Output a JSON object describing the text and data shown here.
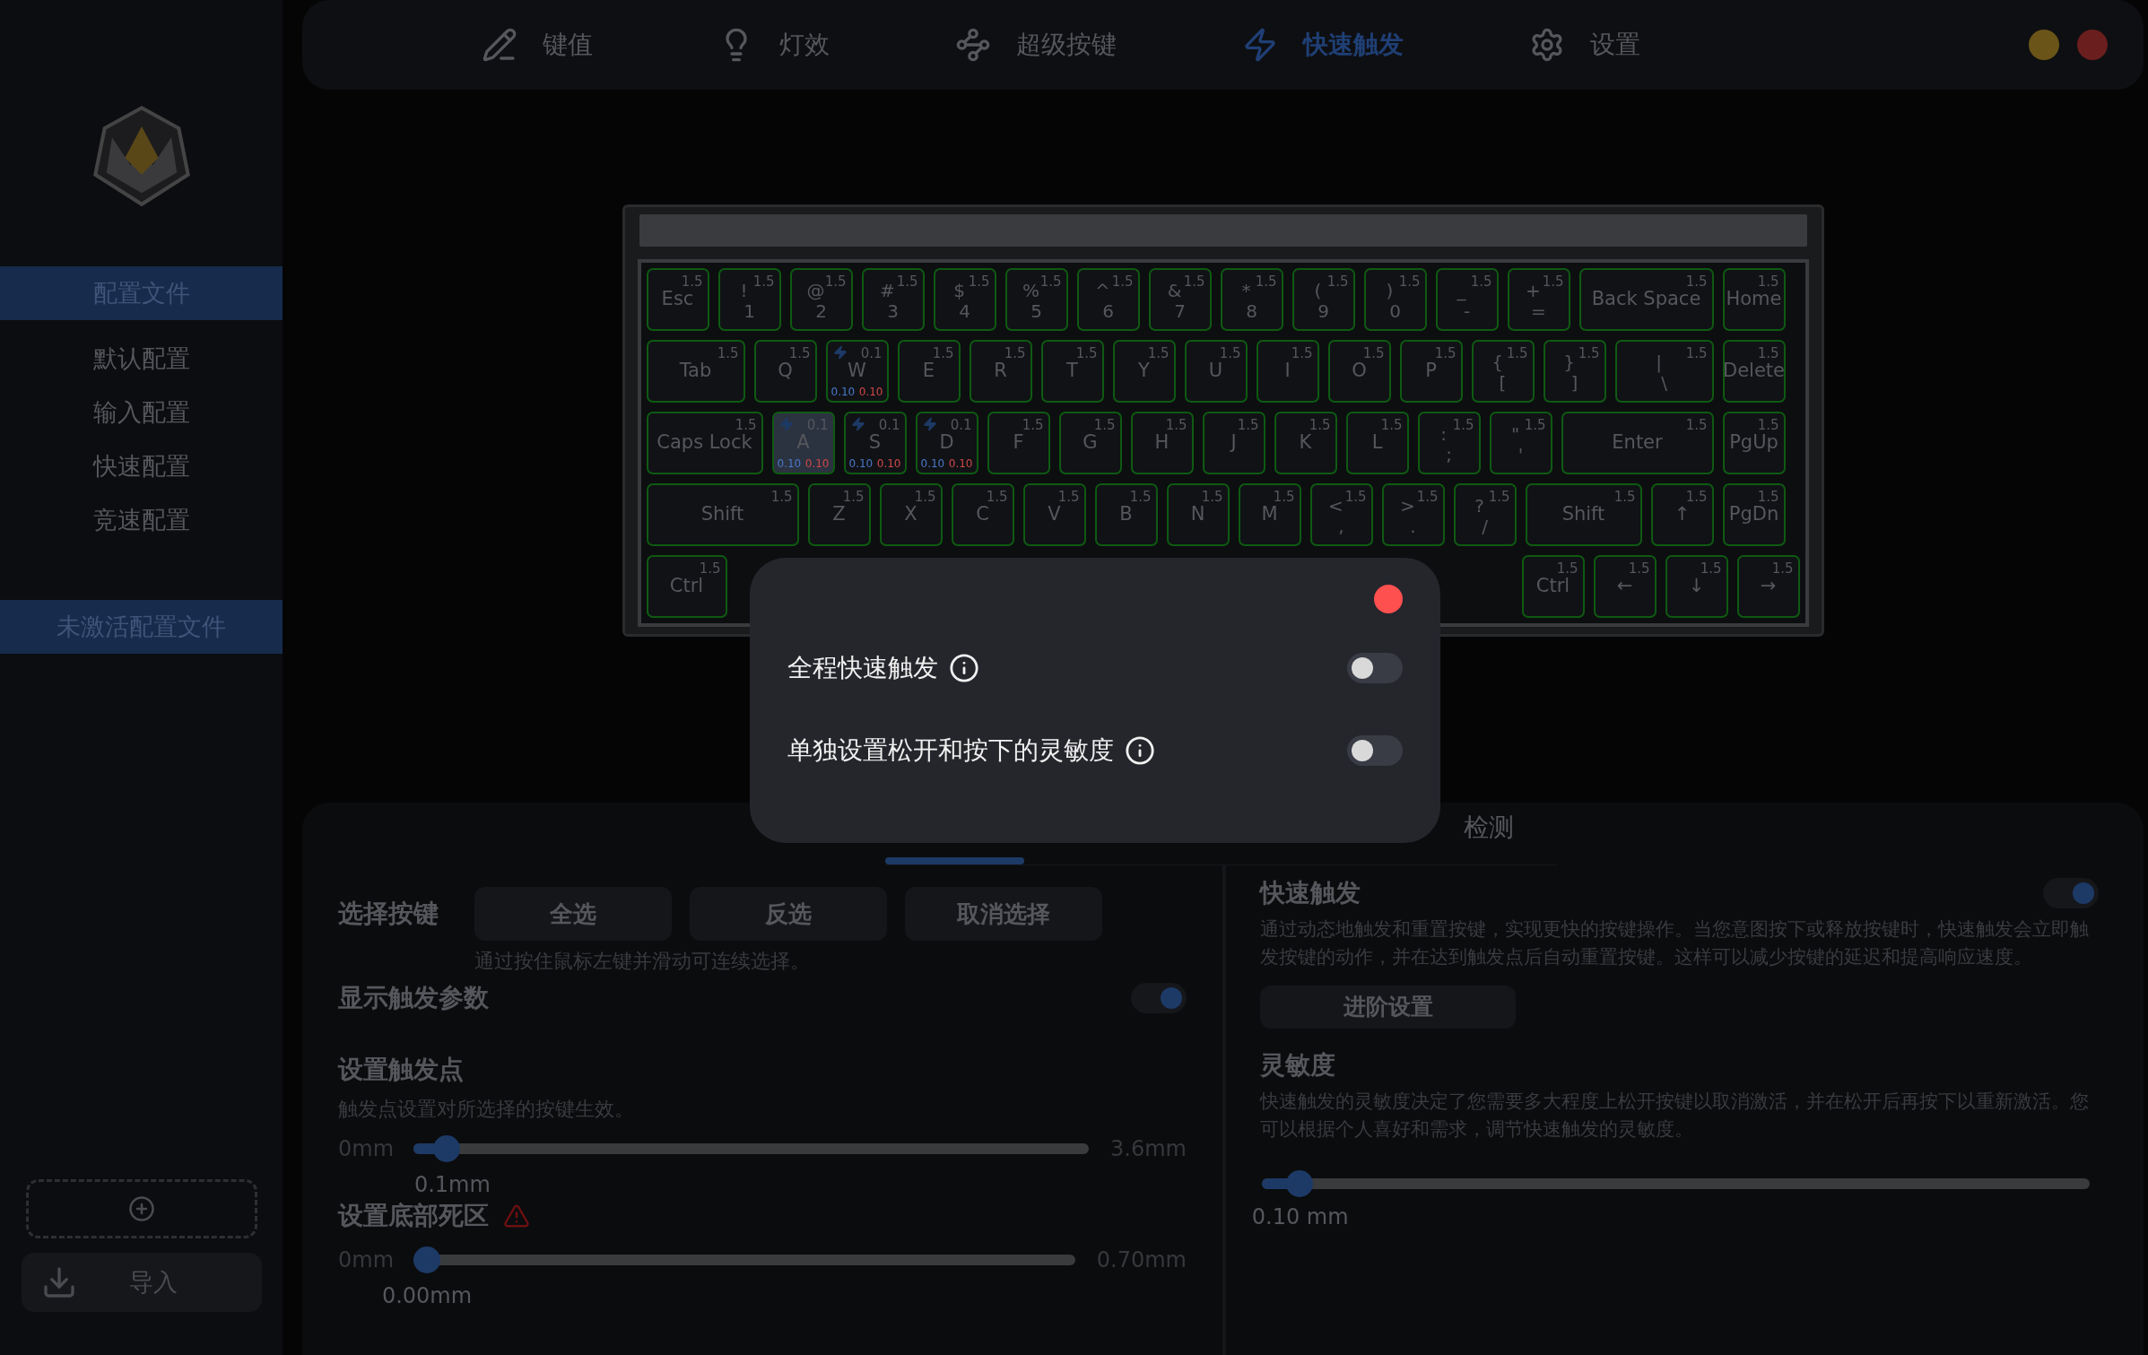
{
  "sidebar": {
    "profiles_header": "配置文件",
    "profiles": [
      "默认配置",
      "输入配置",
      "快速配置",
      "竞速配置"
    ],
    "inactive_header": "未激活配置文件",
    "import_button": "导入"
  },
  "nav": [
    {
      "label": "键值",
      "selected": false
    },
    {
      "label": "灯效",
      "selected": false
    },
    {
      "label": "超级按键",
      "selected": false
    },
    {
      "label": "快速触发",
      "selected": true
    },
    {
      "label": "设置",
      "selected": false
    }
  ],
  "keyboard": {
    "rows": [
      {
        "keys": [
          {
            "label": "Esc",
            "value": "1.5",
            "selected": false
          },
          {
            "top": "!",
            "label": "1",
            "value": "1.5",
            "selected": false
          },
          {
            "top": "@",
            "label": "2",
            "value": "1.5",
            "selected": false
          },
          {
            "top": "#",
            "label": "3",
            "value": "1.5",
            "selected": false
          },
          {
            "top": "$",
            "label": "4",
            "value": "1.5",
            "selected": false
          },
          {
            "top": "%",
            "label": "5",
            "value": "1.5",
            "selected": false
          },
          {
            "top": "^",
            "label": "6",
            "value": "1.5",
            "selected": false
          },
          {
            "top": "&",
            "label": "7",
            "value": "1.5",
            "selected": false
          },
          {
            "top": "*",
            "label": "8",
            "value": "1.5",
            "selected": false
          },
          {
            "top": "(",
            "label": "9",
            "value": "1.5",
            "selected": false
          },
          {
            "top": ")",
            "label": "0",
            "value": "1.5",
            "selected": false
          },
          {
            "top": "_",
            "label": "-",
            "value": "1.5",
            "selected": false
          },
          {
            "top": "+",
            "label": "=",
            "value": "1.5",
            "selected": false
          },
          {
            "label": "Back Space",
            "value": "1.5",
            "selected": false
          },
          {
            "label": "Home",
            "value": "1.5",
            "selected": false
          }
        ]
      },
      {
        "keys": [
          {
            "label": "Tab",
            "value": "1.5",
            "selected": false
          },
          {
            "label": "Q",
            "value": "1.5",
            "selected": false
          },
          {
            "label": "W",
            "value": "0.1",
            "rapid": true,
            "press": "0.10",
            "release": "0.10",
            "selected": false
          },
          {
            "label": "E",
            "value": "1.5",
            "selected": false
          },
          {
            "label": "R",
            "value": "1.5",
            "selected": false
          },
          {
            "label": "T",
            "value": "1.5",
            "selected": false
          },
          {
            "label": "Y",
            "value": "1.5",
            "selected": false
          },
          {
            "label": "U",
            "value": "1.5",
            "selected": false
          },
          {
            "label": "I",
            "value": "1.5",
            "selected": false
          },
          {
            "label": "O",
            "value": "1.5",
            "selected": false
          },
          {
            "label": "P",
            "value": "1.5",
            "selected": false
          },
          {
            "top": "{",
            "label": "[",
            "value": "1.5",
            "selected": false
          },
          {
            "top": "}",
            "label": "]",
            "value": "1.5",
            "selected": false
          },
          {
            "top": "|",
            "label": "\\",
            "value": "1.5",
            "selected": false
          },
          {
            "label": "Delete",
            "value": "1.5",
            "selected": false
          }
        ]
      },
      {
        "keys": [
          {
            "label": "Caps Lock",
            "value": "1.5",
            "selected": false
          },
          {
            "label": "A",
            "value": "0.1",
            "rapid": true,
            "press": "0.10",
            "release": "0.10",
            "selected": true
          },
          {
            "label": "S",
            "value": "0.1",
            "rapid": true,
            "press": "0.10",
            "release": "0.10",
            "selected": false
          },
          {
            "label": "D",
            "value": "0.1",
            "rapid": true,
            "press": "0.10",
            "release": "0.10",
            "selected": false
          },
          {
            "label": "F",
            "value": "1.5",
            "selected": false
          },
          {
            "label": "G",
            "value": "1.5",
            "selected": false
          },
          {
            "label": "H",
            "value": "1.5",
            "selected": false
          },
          {
            "label": "J",
            "value": "1.5",
            "selected": false
          },
          {
            "label": "K",
            "value": "1.5",
            "selected": false
          },
          {
            "label": "L",
            "value": "1.5",
            "selected": false
          },
          {
            "top": ":",
            "label": ";",
            "value": "1.5",
            "selected": false
          },
          {
            "top": "\"",
            "label": "'",
            "value": "1.5",
            "selected": false
          },
          {
            "label": "Enter",
            "value": "1.5",
            "selected": false
          },
          {
            "label": "PgUp",
            "value": "1.5",
            "selected": false
          }
        ]
      },
      {
        "keys": [
          {
            "label": "Shift",
            "value": "1.5",
            "selected": false
          },
          {
            "label": "Z",
            "value": "1.5",
            "selected": false
          },
          {
            "label": "X",
            "value": "1.5",
            "selected": false
          },
          {
            "label": "C",
            "value": "1.5",
            "selected": false
          },
          {
            "label": "V",
            "value": "1.5",
            "selected": false
          },
          {
            "label": "B",
            "value": "1.5",
            "selected": false
          },
          {
            "label": "N",
            "value": "1.5",
            "selected": false
          },
          {
            "label": "M",
            "value": "1.5",
            "selected": false
          },
          {
            "top": "<",
            "label": ",",
            "value": "1.5",
            "selected": false
          },
          {
            "top": ">",
            "label": ".",
            "value": "1.5",
            "selected": false
          },
          {
            "top": "?",
            "label": "/",
            "value": "1.5",
            "selected": false
          },
          {
            "label": "Shift",
            "value": "1.5",
            "selected": false
          },
          {
            "label": "↑",
            "value": "1.5",
            "selected": false
          },
          {
            "label": "PgDn",
            "value": "1.5",
            "selected": false
          }
        ]
      },
      {
        "keys": [
          {
            "label": "Ctrl",
            "value": "1.5",
            "selected": false
          },
          {
            "label": "Ctrl",
            "value": "1.5",
            "selected": false
          },
          {
            "label": "←",
            "value": "1.5",
            "selected": false
          },
          {
            "label": "↓",
            "value": "1.5",
            "selected": false
          },
          {
            "label": "→",
            "value": "1.5",
            "selected": false
          }
        ]
      }
    ]
  },
  "panel": {
    "tabs": [
      {
        "selected": true
      },
      {
        "label": "检测",
        "selected": false
      }
    ],
    "select_keys": {
      "title": "选择按键",
      "buttons": [
        "全选",
        "反选",
        "取消选择"
      ],
      "hint": "通过按住鼠标左键并滑动可连续选择。"
    },
    "show_params": {
      "title": "显示触发参数",
      "on": true
    },
    "trigger_point": {
      "title": "设置触发点",
      "description": "触发点设置对所选择的按键生效。",
      "min": "0mm",
      "max": "3.6mm",
      "value": "0.1mm",
      "level": 0.03
    },
    "dead_zone": {
      "title": "设置底部死区",
      "warning": true,
      "min": "0mm",
      "max": "0.70mm",
      "value": "0.00mm",
      "level": 0
    },
    "rapid_trigger": {
      "title": "快速触发",
      "on": true,
      "description": "通过动态地触发和重置按键，实现更快的按键操作。当您意图按下或释放按键时，快速触发会立即触发按键的动作，并在达到触发点后自动重置按键。这样可以减少按键的延迟和提高响应速度。",
      "advanced_button": "进阶设置"
    },
    "sensitivity": {
      "title": "灵敏度",
      "description": "快速触发的灵敏度决定了您需要多大程度上松开按键以取消激活，并在松开后再按下以重新激活。您可以根据个人喜好和需求，调节快速触发的灵敏度。",
      "value": "0.10 mm",
      "level": 0.03
    }
  },
  "dialog": {
    "options": [
      {
        "label": "全程快速触发",
        "on": false
      },
      {
        "label": "单独设置松开和按下的灵敏度",
        "on": false
      }
    ]
  }
}
